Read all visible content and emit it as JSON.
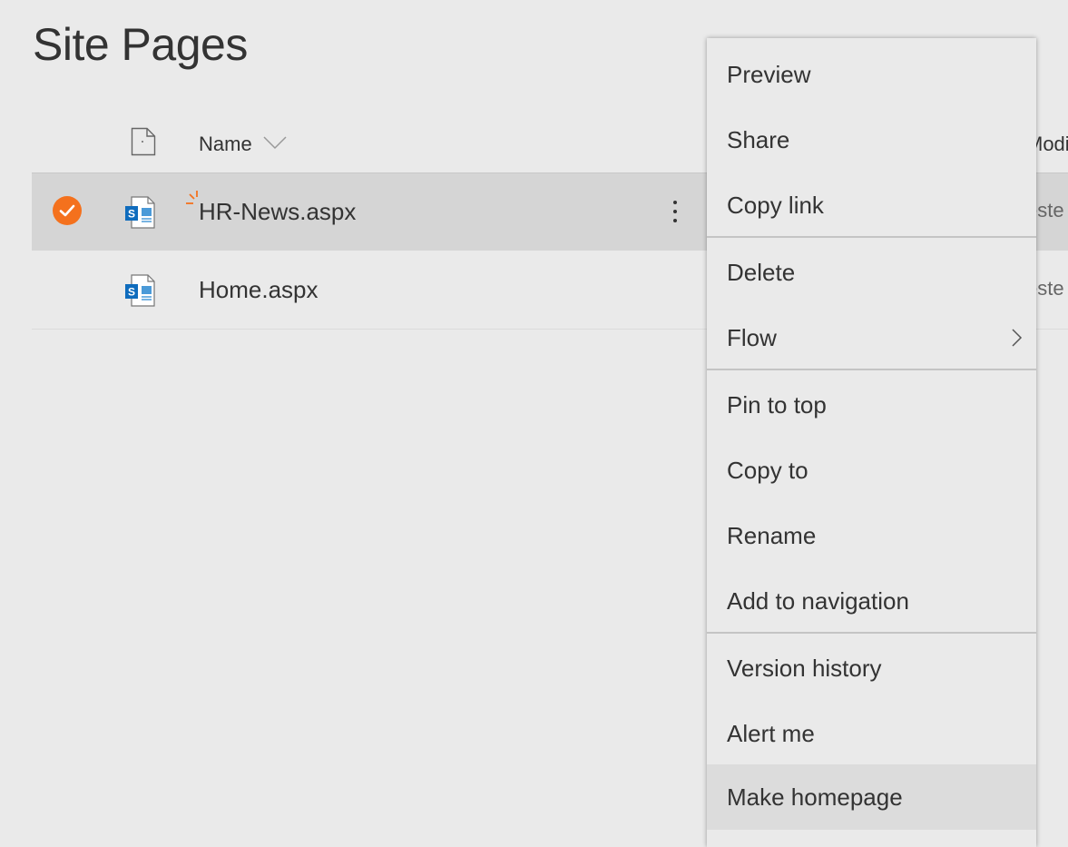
{
  "page": {
    "title": "Site Pages"
  },
  "list": {
    "columns": {
      "name_label": "Name",
      "modified_label": "Modif"
    },
    "rows": [
      {
        "name": "HR-News.aspx",
        "modified_by": "este",
        "selected": true,
        "is_new": true
      },
      {
        "name": "Home.aspx",
        "modified_by": "este",
        "selected": false,
        "is_new": false
      }
    ]
  },
  "context_menu": {
    "items": [
      {
        "label": "Preview"
      },
      {
        "label": "Share"
      },
      {
        "label": "Copy link"
      },
      {
        "label": "Delete"
      },
      {
        "label": "Flow",
        "has_submenu": true
      },
      {
        "label": "Pin to top"
      },
      {
        "label": "Copy to"
      },
      {
        "label": "Rename"
      },
      {
        "label": "Add to navigation"
      },
      {
        "label": "Version history"
      },
      {
        "label": "Alert me"
      },
      {
        "label": "Make homepage",
        "highlighted": true
      }
    ]
  },
  "icons": {
    "check": "check-circle-icon",
    "page_file": "sharepoint-page-icon",
    "generic_file": "document-icon",
    "new_indicator": "new-sparkle-icon",
    "sort": "chevron-down-icon",
    "more": "more-vertical-icon",
    "submenu": "chevron-right-icon"
  },
  "colors": {
    "accent": "#f4711d",
    "sharepoint_blue": "#0f6cbd",
    "background": "#eaeaea",
    "selected_row": "#d5d5d5"
  }
}
